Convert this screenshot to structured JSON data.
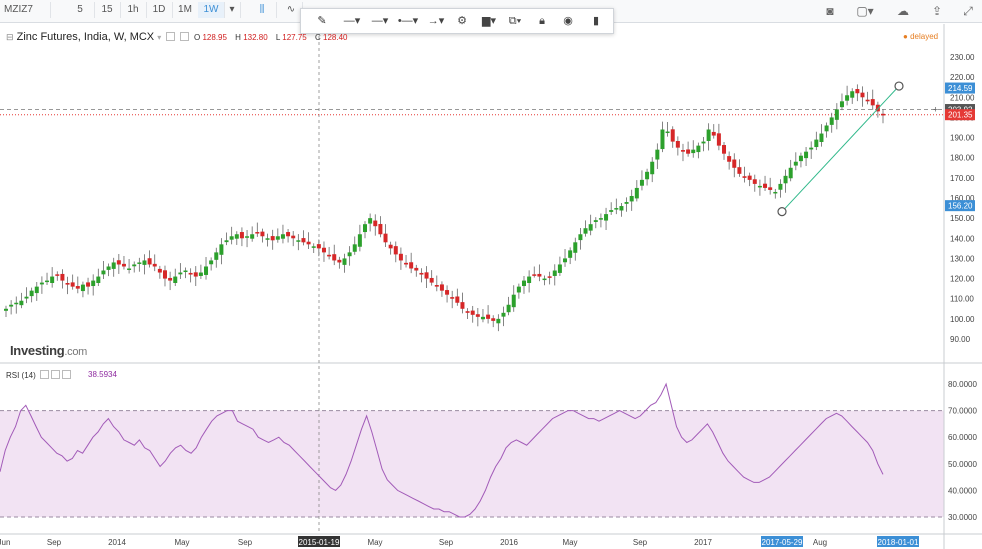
{
  "toolbar": {
    "symbol": "MZIZ7",
    "intervals": [
      "5",
      "15",
      "1h",
      "1D",
      "1M",
      "1W"
    ],
    "active_interval": "1W"
  },
  "drawing_toolbar": {
    "tools": [
      "pencil-icon",
      "line-style-icon",
      "line-width-icon",
      "line-end-icon",
      "arrow-line-icon",
      "gear-icon",
      "fill-color-icon",
      "clone-icon",
      "lock-icon",
      "eye-icon",
      "trash-icon"
    ]
  },
  "chart": {
    "title": "Zinc Futures, India, W, MCX",
    "ohlc": {
      "o_label": "O",
      "o": "128.95",
      "h_label": "H",
      "h": "132.80",
      "l_label": "L",
      "l": "127.75",
      "c_label": "C",
      "c": "128.40"
    },
    "status": "delayed",
    "watermark_brand": "Investing",
    "watermark_domain": ".com",
    "rsi_label": "RSI (14)",
    "rsi_value": "38.5934"
  },
  "colors": {
    "up_candle": "#2ca02c",
    "down_candle": "#d62728",
    "rsi_line": "#a25bb8",
    "rsi_band": "#f2e3f3",
    "price_line": "#e53935",
    "trend_line": "#2fb88a",
    "highlight_label": "#3c8fd6"
  },
  "chart_data": [
    {
      "type": "candlestick",
      "title": "Zinc Futures, India, W, MCX",
      "ylim": [
        90,
        230
      ],
      "y_ticks": [
        "230.00",
        "220.00",
        "210.00",
        "200.00",
        "190.00",
        "180.00",
        "170.00",
        "160.00",
        "150.00",
        "140.00",
        "130.00",
        "120.00",
        "110.00",
        "100.00",
        "90.00"
      ],
      "x_ticks": [
        "Jun",
        "Sep",
        "2014",
        "May",
        "Sep",
        "2015-01-19",
        "May",
        "Sep",
        "2016",
        "May",
        "Sep",
        "2017",
        "2017-05-29",
        "Aug",
        "2018-01-01"
      ],
      "price_labels": [
        {
          "value": "214.59",
          "color": "#3c8fd6"
        },
        {
          "value": "203.92",
          "color": "#555555"
        },
        {
          "value": "201.35",
          "color": "#e53935"
        },
        {
          "value": "156.20",
          "color": "#3c8fd6"
        }
      ],
      "horizontal_lines": [
        203.92,
        201.35
      ],
      "trend_line": {
        "start": {
          "x": "2017-05-29",
          "y": 156.2
        },
        "end": {
          "x": "2018-01-01",
          "y": 214.59
        }
      },
      "close_series": [
        105,
        107,
        108,
        109,
        111,
        114,
        116,
        118,
        119,
        121,
        122,
        119,
        117,
        116,
        115,
        117,
        116,
        119,
        121,
        124,
        126,
        128,
        127,
        126,
        125,
        127,
        128,
        129,
        127,
        126,
        123,
        120,
        119,
        121,
        123,
        124,
        122,
        121,
        123,
        126,
        129,
        133,
        137,
        139,
        141,
        142,
        140,
        141,
        142,
        143,
        141,
        140,
        139,
        141,
        142,
        141,
        140,
        139,
        138,
        137,
        136,
        135,
        133,
        131,
        129,
        128,
        130,
        133,
        137,
        142,
        147,
        150,
        146,
        142,
        138,
        135,
        132,
        129,
        127,
        125,
        124,
        122,
        120,
        118,
        116,
        114,
        112,
        110,
        108,
        105,
        103,
        102,
        101,
        101,
        100,
        99,
        100,
        103,
        107,
        112,
        116,
        119,
        121,
        122,
        121,
        120,
        121,
        124,
        127,
        130,
        134,
        138,
        142,
        145,
        147,
        149,
        150,
        152,
        154,
        155,
        156,
        158,
        161,
        165,
        169,
        173,
        178,
        184,
        194,
        193,
        188,
        185,
        183,
        182,
        184,
        186,
        188,
        194,
        191,
        186,
        182,
        178,
        175,
        172,
        170,
        169,
        167,
        166,
        165,
        164,
        163,
        167,
        171,
        175,
        178,
        181,
        183,
        185,
        189,
        192,
        196,
        200,
        204,
        208,
        211,
        213,
        212,
        210,
        208,
        206,
        203,
        201
      ]
    },
    {
      "type": "line",
      "title": "RSI (14)",
      "ylim": [
        25,
        85
      ],
      "y_ticks": [
        "80.0000",
        "70.0000",
        "60.0000",
        "50.0000",
        "40.0000",
        "30.0000"
      ],
      "band": [
        30,
        70
      ],
      "last_value": 38.5934,
      "series": [
        {
          "values": [
            47,
            55,
            60,
            64,
            70,
            72,
            68,
            64,
            60,
            58,
            56,
            54,
            53,
            51,
            52,
            55,
            54,
            57,
            60,
            62,
            65,
            67,
            64,
            62,
            59,
            58,
            57,
            59,
            56,
            55,
            52,
            49,
            51,
            54,
            56,
            57,
            55,
            54,
            56,
            60,
            63,
            66,
            68,
            69,
            70,
            70,
            66,
            65,
            64,
            63,
            60,
            59,
            58,
            59,
            60,
            58,
            57,
            55,
            53,
            51,
            49,
            47,
            45,
            43,
            41,
            40,
            42,
            46,
            51,
            57,
            63,
            68,
            62,
            55,
            48,
            44,
            42,
            40,
            39,
            38,
            37,
            36,
            35,
            34,
            33,
            33,
            32,
            32,
            31,
            30,
            30,
            31,
            33,
            36,
            40,
            45,
            49,
            52,
            56,
            58,
            59,
            58,
            57,
            59,
            61,
            63,
            65,
            67,
            68,
            69,
            70,
            70,
            69,
            68,
            67,
            67,
            66,
            67,
            68,
            69,
            70,
            69,
            68,
            67,
            68,
            70,
            72,
            73,
            76,
            80,
            72,
            64,
            60,
            58,
            59,
            61,
            63,
            65,
            62,
            58,
            54,
            51,
            49,
            47,
            45,
            44,
            43,
            43,
            44,
            45,
            47,
            49,
            51,
            53,
            55,
            57,
            59,
            61,
            63,
            65,
            67,
            68,
            69,
            68,
            66,
            64,
            62,
            60,
            58,
            55,
            50,
            46
          ]
        }
      ]
    }
  ]
}
